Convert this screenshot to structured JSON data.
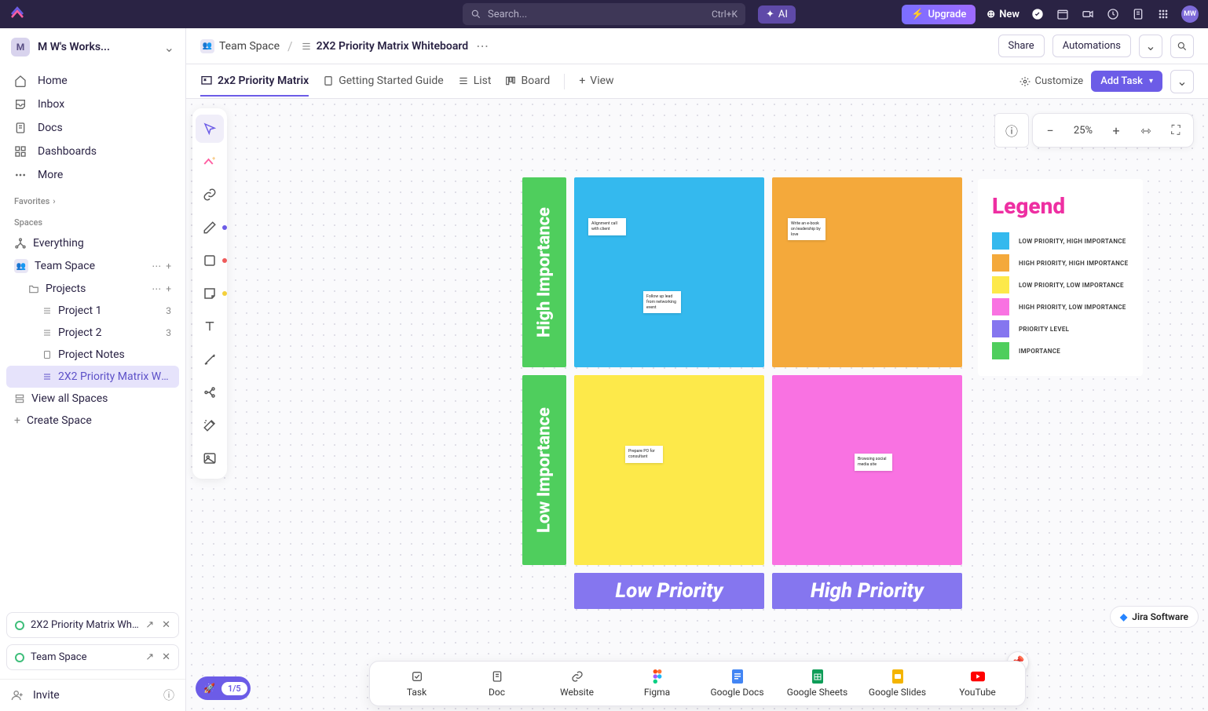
{
  "topbar": {
    "search_placeholder": "Search...",
    "search_shortcut": "Ctrl+K",
    "ai_label": "AI",
    "upgrade_label": "Upgrade",
    "new_label": "New",
    "avatar_initials": "MW"
  },
  "workspace": {
    "initial": "M",
    "name": "M W's Works..."
  },
  "nav": {
    "home": "Home",
    "inbox": "Inbox",
    "docs": "Docs",
    "dashboards": "Dashboards",
    "more": "More"
  },
  "sections": {
    "favorites": "Favorites",
    "spaces": "Spaces"
  },
  "tree": {
    "everything": "Everything",
    "team_space": "Team Space",
    "projects": "Projects",
    "project1": "Project 1",
    "project1_count": "3",
    "project2": "Project 2",
    "project2_count": "3",
    "project_notes": "Project Notes",
    "matrix_wb": "2X2 Priority Matrix Whiteb...",
    "view_all": "View all Spaces",
    "create_space": "Create Space"
  },
  "chips": {
    "c1": "2X2 Priority Matrix Whi...",
    "c2": "Team Space"
  },
  "footer": {
    "invite": "Invite"
  },
  "breadcrumb": {
    "space": "Team Space",
    "page": "2X2 Priority Matrix Whiteboard",
    "share": "Share",
    "automations": "Automations"
  },
  "tabs": {
    "t1": "2x2 Priority Matrix",
    "t2": "Getting Started Guide",
    "t3": "List",
    "t4": "Board",
    "t5": "View",
    "customize": "Customize",
    "add_task": "Add Task"
  },
  "zoom": {
    "level": "25%"
  },
  "matrix": {
    "axis_high_imp": "High Importance",
    "axis_low_imp": "Low Importance",
    "axis_low_pri": "Low Priority",
    "axis_high_pri": "High Priority",
    "colors": {
      "axis_v": "#4fce5d",
      "axis_h": "#8576ef",
      "q_blue": "#34b9ee",
      "q_orange": "#f4a93b",
      "q_yellow": "#fde94a",
      "q_pink": "#f972e2"
    },
    "notes": {
      "n1": "Alignment call with client",
      "n2": "Follow up lead from networking event",
      "n3": "Write an e-book on leadership by love",
      "n4": "Prepare PO for consultant",
      "n5": "Browsing social media site"
    }
  },
  "legend": {
    "title": "Legend",
    "items": [
      {
        "label": "LOW PRIORITY, HIGH IMPORTANCE",
        "color": "#34b9ee"
      },
      {
        "label": "HIGH PRIORITY, HIGH IMPORTANCE",
        "color": "#f4a93b"
      },
      {
        "label": "LOW PRIORITY, LOW IMPORTANCE",
        "color": "#fde94a"
      },
      {
        "label": "HIGH PRIORITY, LOW IMPORTANCE",
        "color": "#f972e2"
      },
      {
        "label": "PRIORITY LEVEL",
        "color": "#8576ef"
      },
      {
        "label": "IMPORTANCE",
        "color": "#4fce5d"
      }
    ]
  },
  "jira": {
    "label": "Jira Software"
  },
  "ratio": {
    "text": "1/5"
  },
  "create_bar": {
    "items": [
      "Task",
      "Doc",
      "Website",
      "Figma",
      "Google Docs",
      "Google Sheets",
      "Google Slides",
      "YouTube"
    ]
  }
}
